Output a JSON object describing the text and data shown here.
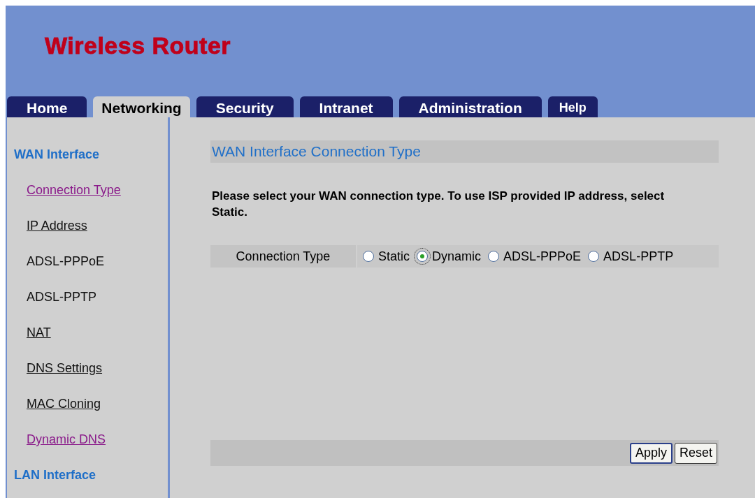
{
  "header": {
    "title": "Wireless Router"
  },
  "tabs": [
    {
      "label": "Home",
      "selected": false
    },
    {
      "label": "Networking",
      "selected": true
    },
    {
      "label": "Security",
      "selected": false
    },
    {
      "label": "Intranet",
      "selected": false
    },
    {
      "label": "Administration",
      "selected": false
    },
    {
      "label": "Help",
      "selected": false
    }
  ],
  "sidebar": {
    "items": [
      {
        "label": "WAN Interface",
        "kind": "heading"
      },
      {
        "label": "Connection Type",
        "kind": "visited"
      },
      {
        "label": "IP Address",
        "kind": "link"
      },
      {
        "label": "ADSL-PPPoE",
        "kind": "plain"
      },
      {
        "label": "ADSL-PPTP",
        "kind": "plain"
      },
      {
        "label": "NAT",
        "kind": "link"
      },
      {
        "label": "DNS Settings",
        "kind": "link"
      },
      {
        "label": "MAC Cloning",
        "kind": "link"
      },
      {
        "label": "Dynamic DNS",
        "kind": "visited"
      },
      {
        "label": "LAN Interface",
        "kind": "heading"
      }
    ]
  },
  "content": {
    "title": "WAN Interface Connection Type",
    "instructions": "Please select your WAN connection type. To use ISP provided IP address, select Static.",
    "connection_type": {
      "label": "Connection Type",
      "options": [
        {
          "label": "Static",
          "selected": false,
          "focused": false
        },
        {
          "label": "Dynamic",
          "selected": true,
          "focused": true
        },
        {
          "label": "ADSL-PPPoE",
          "selected": false,
          "focused": false
        },
        {
          "label": "ADSL-PPTP",
          "selected": false,
          "focused": false
        }
      ]
    },
    "buttons": [
      {
        "label": "Apply",
        "default": true
      },
      {
        "label": "Reset",
        "default": false
      }
    ]
  }
}
